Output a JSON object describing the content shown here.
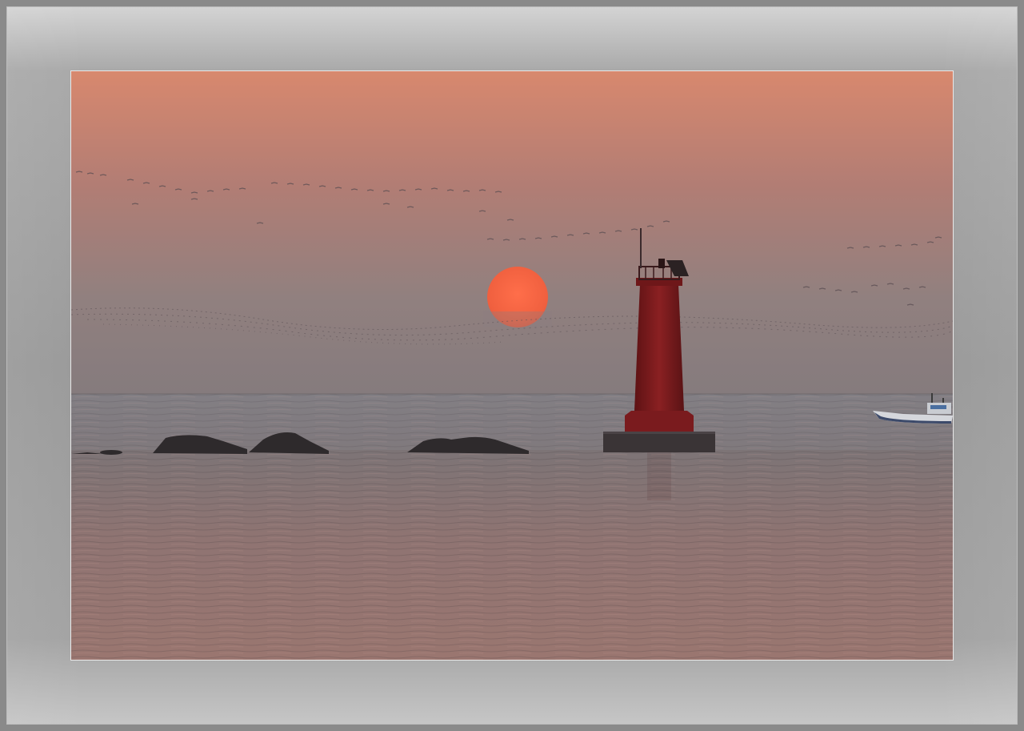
{
  "image": {
    "subject": "",
    "colors": {
      "frame": "#9a9a9a",
      "sky_top": "#d9876b",
      "sky_bottom": "#8a7a7e",
      "sun": "#f2674a",
      "lighthouse": "#7c1a1d",
      "sea": "#7f7576"
    }
  }
}
